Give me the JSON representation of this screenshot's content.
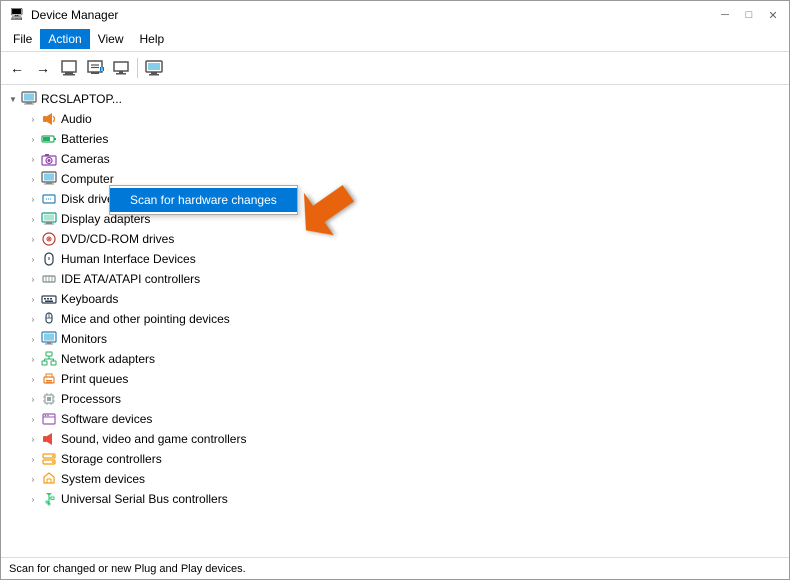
{
  "window": {
    "title": "Device Manager",
    "icon": "🖥"
  },
  "window_controls": {
    "minimize": "─",
    "maximize": "□",
    "close": "✕"
  },
  "menu": {
    "items": [
      {
        "label": "File",
        "active": false
      },
      {
        "label": "Action",
        "active": true
      },
      {
        "label": "View",
        "active": false
      },
      {
        "label": "Help",
        "active": false
      }
    ]
  },
  "toolbar": {
    "buttons": [
      "←",
      "→",
      "⊞",
      "ℹ",
      "▶",
      "✖",
      "🖥"
    ]
  },
  "tree": {
    "root": {
      "label": "RCSLAPTOP...",
      "icon": "💻",
      "expanded": true
    },
    "items": [
      {
        "label": "Audio",
        "icon": "🔊",
        "indent": 2,
        "expanded": false
      },
      {
        "label": "Batteries",
        "icon": "🔋",
        "indent": 2,
        "expanded": false
      },
      {
        "label": "Cameras",
        "icon": "📷",
        "indent": 2,
        "expanded": false
      },
      {
        "label": "Computer",
        "icon": "🖥",
        "indent": 2,
        "expanded": false
      },
      {
        "label": "Disk drives",
        "icon": "💾",
        "indent": 2,
        "expanded": false
      },
      {
        "label": "Display adapters",
        "icon": "🖵",
        "indent": 2,
        "expanded": false
      },
      {
        "label": "DVD/CD-ROM drives",
        "icon": "💿",
        "indent": 2,
        "expanded": false
      },
      {
        "label": "Human Interface Devices",
        "icon": "🕹",
        "indent": 2,
        "expanded": false
      },
      {
        "label": "IDE ATA/ATAPI controllers",
        "icon": "⚙",
        "indent": 2,
        "expanded": false
      },
      {
        "label": "Keyboards",
        "icon": "⌨",
        "indent": 2,
        "expanded": false
      },
      {
        "label": "Mice and other pointing devices",
        "icon": "🖱",
        "indent": 2,
        "expanded": false
      },
      {
        "label": "Monitors",
        "icon": "🖥",
        "indent": 2,
        "expanded": false
      },
      {
        "label": "Network adapters",
        "icon": "🌐",
        "indent": 2,
        "expanded": false
      },
      {
        "label": "Print queues",
        "icon": "🖨",
        "indent": 2,
        "expanded": false
      },
      {
        "label": "Processors",
        "icon": "⚙",
        "indent": 2,
        "expanded": false
      },
      {
        "label": "Software devices",
        "icon": "📦",
        "indent": 2,
        "expanded": false
      },
      {
        "label": "Sound, video and game controllers",
        "icon": "🔊",
        "indent": 2,
        "expanded": false
      },
      {
        "label": "Storage controllers",
        "icon": "💽",
        "indent": 2,
        "expanded": false
      },
      {
        "label": "System devices",
        "icon": "📁",
        "indent": 2,
        "expanded": false
      },
      {
        "label": "Universal Serial Bus controllers",
        "icon": "🔌",
        "indent": 2,
        "expanded": false
      }
    ]
  },
  "context_menu": {
    "item": "Scan for hardware changes"
  },
  "status_bar": {
    "text": "Scan for changed or new Plug and Play devices."
  }
}
